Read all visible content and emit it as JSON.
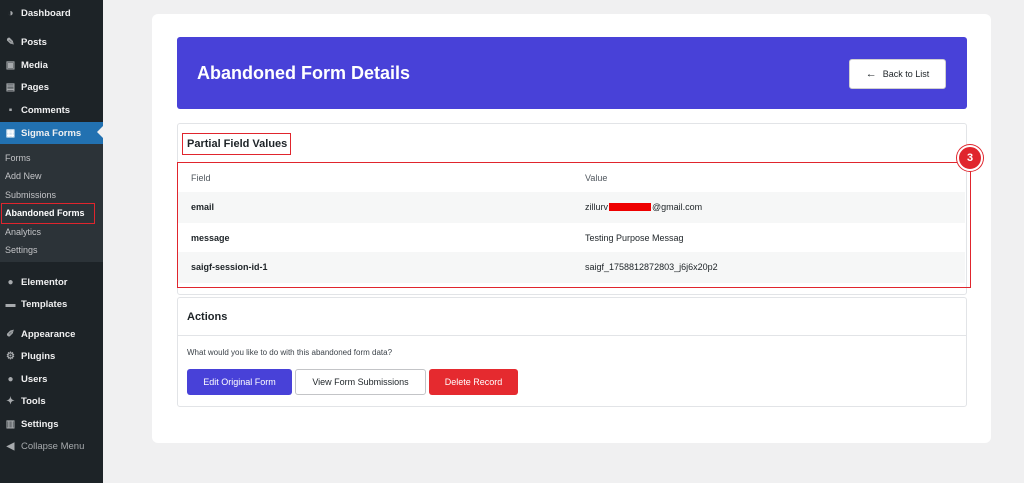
{
  "sidebar": {
    "items": [
      {
        "label": "Dashboard",
        "icon": "dashboard-icon",
        "glyph": "◑"
      },
      {
        "label": "Posts",
        "icon": "pushpin-icon",
        "glyph": "✎"
      },
      {
        "label": "Media",
        "icon": "media-icon",
        "glyph": "▣"
      },
      {
        "label": "Pages",
        "icon": "pages-icon",
        "glyph": "▤"
      },
      {
        "label": "Comments",
        "icon": "comment-icon",
        "glyph": "▪"
      },
      {
        "label": "Sigma Forms",
        "icon": "form-icon",
        "glyph": "▦"
      },
      {
        "label": "Elementor",
        "icon": "elementor-icon",
        "glyph": "●"
      },
      {
        "label": "Templates",
        "icon": "folder-icon",
        "glyph": "▬"
      },
      {
        "label": "Appearance",
        "icon": "paintbrush-icon",
        "glyph": "✐"
      },
      {
        "label": "Plugins",
        "icon": "plugin-icon",
        "glyph": "⚙"
      },
      {
        "label": "Users",
        "icon": "user-icon",
        "glyph": "●"
      },
      {
        "label": "Tools",
        "icon": "wrench-icon",
        "glyph": "✦"
      },
      {
        "label": "Settings",
        "icon": "settings-icon",
        "glyph": "▥"
      }
    ],
    "submenu": [
      "Forms",
      "Add New",
      "Submissions",
      "Abandoned Forms",
      "Analytics",
      "Settings"
    ],
    "collapse": {
      "label": "Collapse Menu",
      "icon": "collapse-icon",
      "glyph": "◀"
    }
  },
  "header": {
    "title": "Abandoned Form Details",
    "back_label": "Back to List"
  },
  "partial": {
    "title": "Partial Field Values",
    "badge": "3",
    "columns": [
      "Field",
      "Value"
    ],
    "rows": [
      {
        "field": "email",
        "value_prefix": "zillurv",
        "value_suffix": "@gmail.com"
      },
      {
        "field": "message",
        "value": "Testing Purpose Messag"
      },
      {
        "field": "saigf-session-id-1",
        "value": "saigf_1758812872803_j6j6x20p2"
      }
    ]
  },
  "actions": {
    "title": "Actions",
    "description": "What would you like to do with this abandoned form data?",
    "edit_label": "Edit Original Form",
    "view_label": "View Form Submissions",
    "delete_label": "Delete Record"
  },
  "colors": {
    "accent": "#4841d8",
    "danger": "#e52a2f",
    "sidebar_bg": "#1d2327",
    "active": "#2271b1"
  }
}
